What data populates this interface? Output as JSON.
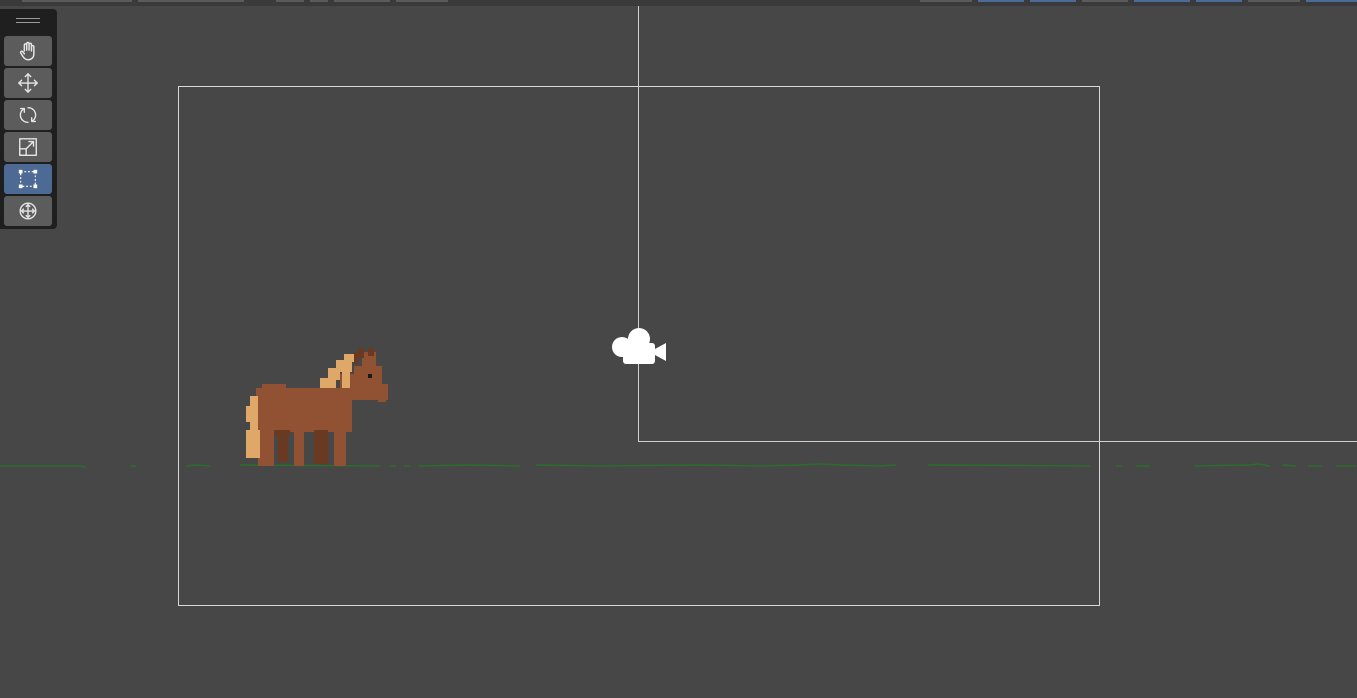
{
  "colors": {
    "viewport_bg": "#474747",
    "toolbar_bg": "#1f1f1f",
    "tool_bg": "#5c5c5c",
    "tool_active_bg": "#4c6a94",
    "camera_frame": "#d8d8d8",
    "ground_line": "#2b6e2b",
    "horse_body": "#915233",
    "horse_mane": "#e0a868"
  },
  "toolbar": {
    "tools": [
      {
        "id": "pan",
        "icon": "hand-icon",
        "active": false
      },
      {
        "id": "move",
        "icon": "move-arrows-icon",
        "active": false
      },
      {
        "id": "rotate",
        "icon": "rotate-icon",
        "active": false
      },
      {
        "id": "scale",
        "icon": "scale-icon",
        "active": false
      },
      {
        "id": "rect",
        "icon": "rect-transform-icon",
        "active": true
      },
      {
        "id": "transform",
        "icon": "transform-icon",
        "active": false
      }
    ]
  },
  "scene": {
    "camera_gizmo": "camera-icon",
    "sprite": "horse-sprite"
  }
}
